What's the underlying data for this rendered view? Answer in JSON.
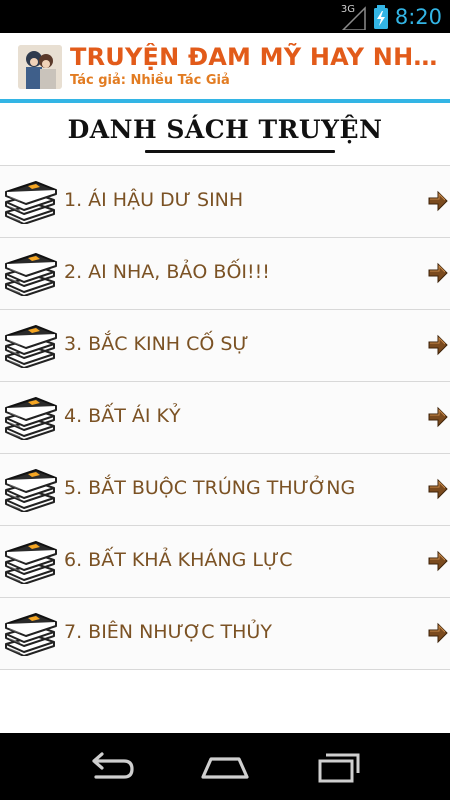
{
  "status_bar": {
    "network": "3G",
    "time": "8:20"
  },
  "app_bar": {
    "title": "TRUYỆN ĐAM MỸ HAY NHẤT P...",
    "subtitle": "Tác giả: Nhiều Tác Giả",
    "title_color": "#e25b1a",
    "accent_line_color": "#33b5e5"
  },
  "list_heading": "DANH SÁCH TRUYỆN",
  "stories": [
    {
      "label": "1. ÁI HẬU DƯ SINH"
    },
    {
      "label": "2. AI NHA, BẢO BỐI!!!"
    },
    {
      "label": "3. BẮC KINH CỐ SỰ"
    },
    {
      "label": "4. BẤT ÁI KỶ"
    },
    {
      "label": "5. BẮT BUỘC TRÚNG THƯỞNG"
    },
    {
      "label": "6. BẤT KHẢ KHÁNG LỰC"
    },
    {
      "label": "7. BIÊN NHƯỢC THỦY"
    }
  ],
  "icons": {
    "row_icon": "book-stack-icon",
    "row_chevron": "arrow-right-icon",
    "nav": [
      "back-icon",
      "home-icon",
      "recent-apps-icon"
    ]
  }
}
